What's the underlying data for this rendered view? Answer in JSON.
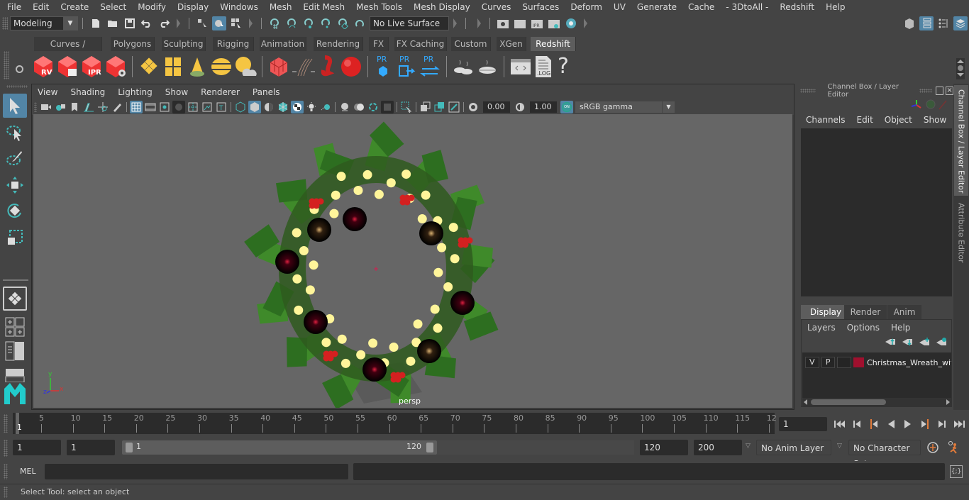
{
  "menubar": {
    "items": [
      "File",
      "Edit",
      "Create",
      "Select",
      "Modify",
      "Display",
      "Windows",
      "Mesh",
      "Edit Mesh",
      "Mesh Tools",
      "Mesh Display",
      "Curves",
      "Surfaces",
      "Deform",
      "UV",
      "Generate",
      "Cache",
      "- 3DtoAll -",
      "Redshift",
      "Help"
    ]
  },
  "statusline": {
    "workspace": "Modeling",
    "live_surface": "No Live Surface"
  },
  "shelf": {
    "tabs": [
      "Curves / Surfaces",
      "Polygons",
      "Sculpting",
      "Rigging",
      "Animation",
      "Rendering",
      "FX",
      "FX Caching",
      "Custom",
      "XGen",
      "Redshift"
    ],
    "active_tab": "Redshift",
    "icons": {
      "rv": "RV",
      "ipr": "IPR",
      "pr": "PR",
      "log": ".LOG",
      "help": "?"
    }
  },
  "viewport": {
    "menu": [
      "View",
      "Shading",
      "Lighting",
      "Show",
      "Renderer",
      "Panels"
    ],
    "exposure": "0.00",
    "gamma": "1.00",
    "color_mgmt_toggle": "ON",
    "color_space": "sRGB gamma",
    "camera": "persp",
    "axis": {
      "x": "x",
      "y": "y",
      "z": "z"
    }
  },
  "channel_box": {
    "title": "Channel Box / Layer Editor",
    "menu": [
      "Channels",
      "Edit",
      "Object",
      "Show"
    ],
    "layer_tabs": [
      "Display",
      "Render",
      "Anim"
    ],
    "active_layer_tab": "Display",
    "layer_menu": [
      "Layers",
      "Options",
      "Help"
    ],
    "layers": [
      {
        "v": "V",
        "p": "P",
        "color": "#a0102e",
        "name": "Christmas_Wreath_wit"
      }
    ]
  },
  "side_tabs": [
    "Channel Box / Layer Editor",
    "Attribute Editor"
  ],
  "timeline": {
    "ticks": [
      5,
      10,
      15,
      20,
      25,
      30,
      35,
      40,
      45,
      50,
      55,
      60,
      65,
      70,
      75,
      80,
      85,
      90,
      95,
      100,
      105,
      110,
      115,
      "12"
    ],
    "current_frame_marker": "1",
    "current_frame": "1"
  },
  "range": {
    "start": "1",
    "playback_start": "1",
    "slider_min": "1",
    "slider_max": "120",
    "playback_end": "120",
    "end": "200",
    "anim_layer": "No Anim Layer",
    "character_set": "No Character Set"
  },
  "command": {
    "language": "MEL",
    "input": "",
    "output": ""
  },
  "help_line": "Select Tool: select an object"
}
